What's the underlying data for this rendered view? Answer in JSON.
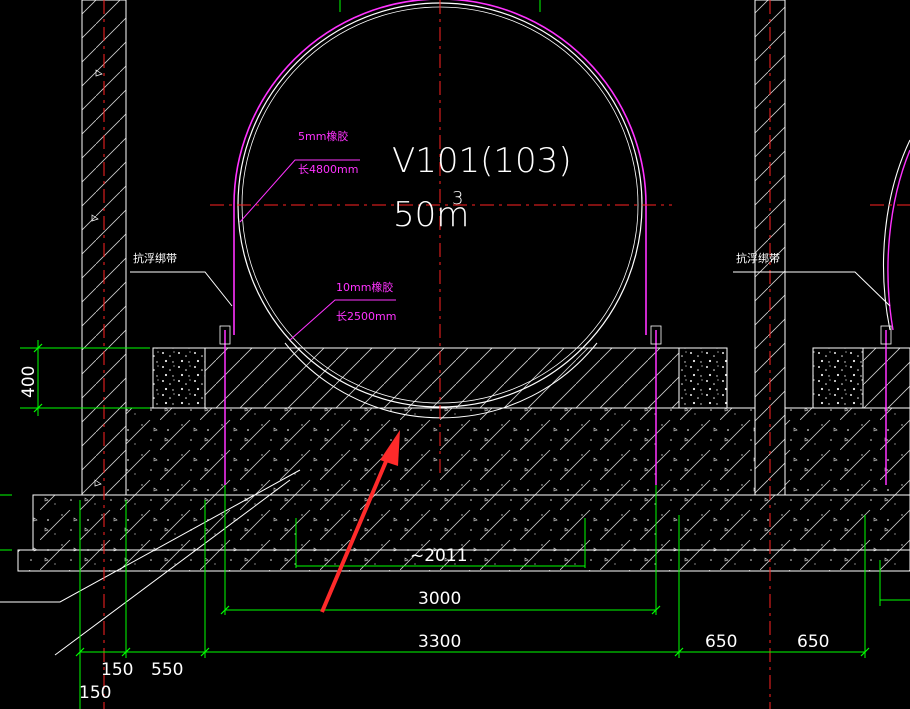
{
  "tank": {
    "id": "V101(103)",
    "volume_value": "50m",
    "volume_superscript": "3"
  },
  "annotations": {
    "rubber_5mm_title": "5mm橡胶",
    "rubber_5mm_length": "长4800mm",
    "rubber_10mm_title": "10mm橡胶",
    "rubber_10mm_length": "长2500mm",
    "anti_float_strap_left": "抗浮绑带",
    "anti_float_strap_right": "抗浮绑带"
  },
  "dimensions": {
    "height_400": "400",
    "approx_2011": "~2011",
    "width_3000": "3000",
    "width_3300": "3300",
    "width_650_a": "650",
    "width_650_b": "650",
    "width_150_a": "150",
    "width_550": "550",
    "width_150_b": "150"
  },
  "colors": {
    "background": "#000000",
    "structure": "#ffffff",
    "dimension": "#00ff00",
    "centerline": "#ff2222",
    "rubber": "#ff33ff",
    "arrow": "#ff2a2a"
  }
}
